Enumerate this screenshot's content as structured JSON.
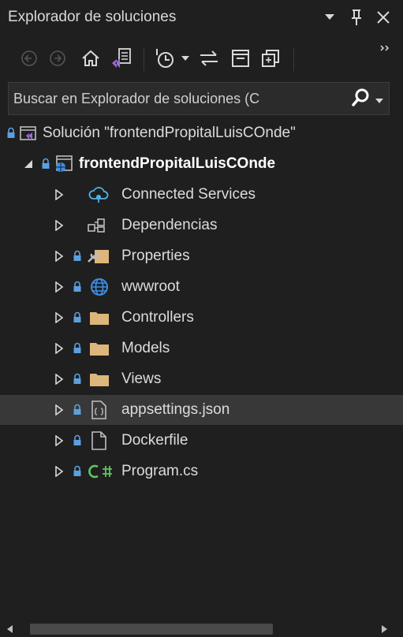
{
  "window": {
    "title": "Explorador de soluciones"
  },
  "search": {
    "placeholder": "Buscar en Explorador de soluciones (C"
  },
  "tree": {
    "solution": "Solución \"frontendPropitalLuisCOnde\"",
    "project": "frontendPropitalLuisCOnde",
    "items": [
      {
        "label": "Connected Services",
        "icon": "connected-services-icon"
      },
      {
        "label": "Dependencias",
        "icon": "dependencies-icon"
      },
      {
        "label": "Properties",
        "icon": "properties-icon"
      },
      {
        "label": "wwwroot",
        "icon": "globe-icon"
      },
      {
        "label": "Controllers",
        "icon": "folder-icon"
      },
      {
        "label": "Models",
        "icon": "folder-icon"
      },
      {
        "label": "Views",
        "icon": "folder-icon"
      },
      {
        "label": "appsettings.json",
        "icon": "json-file-icon"
      },
      {
        "label": "Dockerfile",
        "icon": "file-icon"
      },
      {
        "label": "Program.cs",
        "icon": "csharp-file-icon"
      }
    ],
    "selected_item": "appsettings.json"
  },
  "colors": {
    "background": "#1f1f1f",
    "selected_row": "#383838",
    "folder": "#dcb67a",
    "globe": "#3c8ee6",
    "solution_purple": "#9b6cd4",
    "lock": "#5aa0e0",
    "csharp": "#5ec75e",
    "connected_services": "#4fb3e8"
  }
}
